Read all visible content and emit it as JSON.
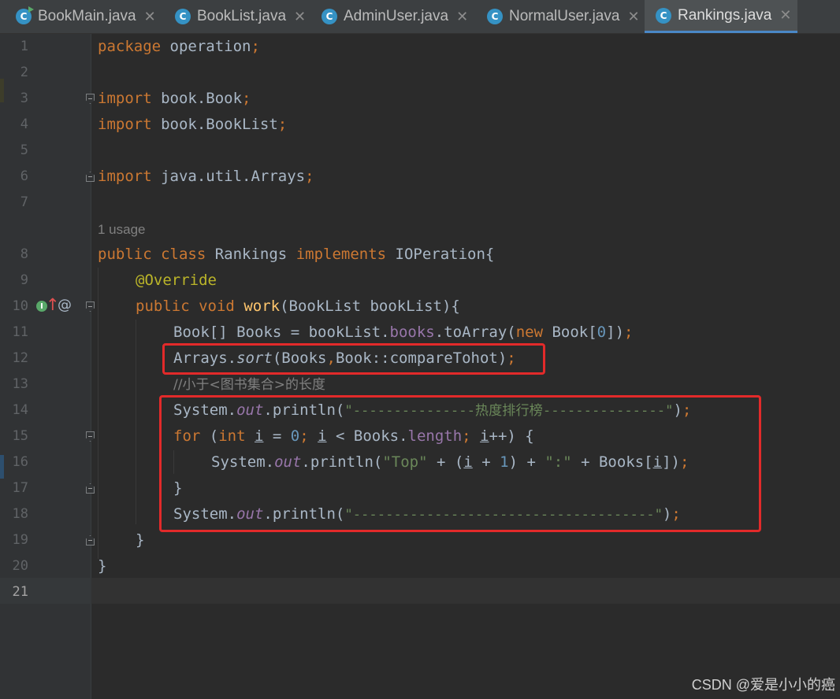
{
  "tabs": [
    {
      "label": "BookMain.java",
      "icon": "java-class-runnable-icon",
      "active": false
    },
    {
      "label": "BookList.java",
      "icon": "java-class-icon",
      "active": false
    },
    {
      "label": "AdminUser.java",
      "icon": "java-class-icon",
      "active": false
    },
    {
      "label": "NormalUser.java",
      "icon": "java-class-icon",
      "active": false
    },
    {
      "label": "Rankings.java",
      "icon": "java-class-icon",
      "active": true
    }
  ],
  "tab_icon_letter": "C",
  "tab_close_glyph": "✕",
  "line_numbers": [
    "1",
    "2",
    "3",
    "4",
    "5",
    "6",
    "7",
    "8",
    "9",
    "10",
    "11",
    "12",
    "13",
    "14",
    "15",
    "16",
    "17",
    "18",
    "19",
    "20",
    "21"
  ],
  "current_line": "21",
  "usage_hint": "1 usage",
  "code": {
    "l1": [
      "package",
      " operation",
      ";"
    ],
    "l3": [
      "import",
      " book.Book",
      ";"
    ],
    "l4": [
      "import",
      " book.BookList",
      ";"
    ],
    "l6": [
      "import",
      " java.util.Arrays",
      ";"
    ],
    "l8": [
      "public",
      " ",
      "class",
      " Rankings ",
      "implements",
      " IOPeration{"
    ],
    "l9": [
      "@Override"
    ],
    "l10": [
      "public",
      " ",
      "void",
      " ",
      "work",
      "(BookList bookList){"
    ],
    "l11": [
      "Book[] Books = bookList.",
      "books",
      ".toArray(",
      "new",
      " Book[",
      "0",
      "])",
      ";"
    ],
    "l12": [
      "Arrays.",
      "sort",
      "(Books",
      ",",
      "Book::compareTohot)",
      ";"
    ],
    "l13": [
      "//小于<图书集合>的长度"
    ],
    "l14": [
      "System.",
      "out",
      ".println(",
      "\"---------------热度排行榜---------------\"",
      ")",
      ";"
    ],
    "l15": [
      "for",
      " (",
      "int",
      " ",
      "i",
      " = ",
      "0",
      "; ",
      "i",
      " < Books.",
      "length",
      "; ",
      "i",
      "++) {"
    ],
    "l16": [
      "System.",
      "out",
      ".println(",
      "\"Top\"",
      " + (",
      "i",
      " + ",
      "1",
      ") + ",
      "\":\"",
      " + Books[",
      "i",
      "])",
      ";"
    ],
    "l17": [
      "}"
    ],
    "l18": [
      "System.",
      "out",
      ".println(",
      "\"-------------------------------------\"",
      ")",
      ";"
    ],
    "l19": [
      "}"
    ],
    "l20": [
      "}"
    ]
  },
  "gutter_icons": {
    "implements_marker": "I",
    "up_arrow": "↑",
    "annotation_marker": "@"
  },
  "colors": {
    "background": "#2b2b2b",
    "keyword": "#cc7832",
    "annotation": "#bbb529",
    "method_decl": "#ffc66d",
    "field": "#9876aa",
    "string": "#6a8759",
    "number": "#6897bb",
    "comment": "#808080",
    "highlight_box": "#e22a2a",
    "active_tab_underline": "#4a88c7"
  },
  "watermark": "CSDN @爱是小小的癌"
}
